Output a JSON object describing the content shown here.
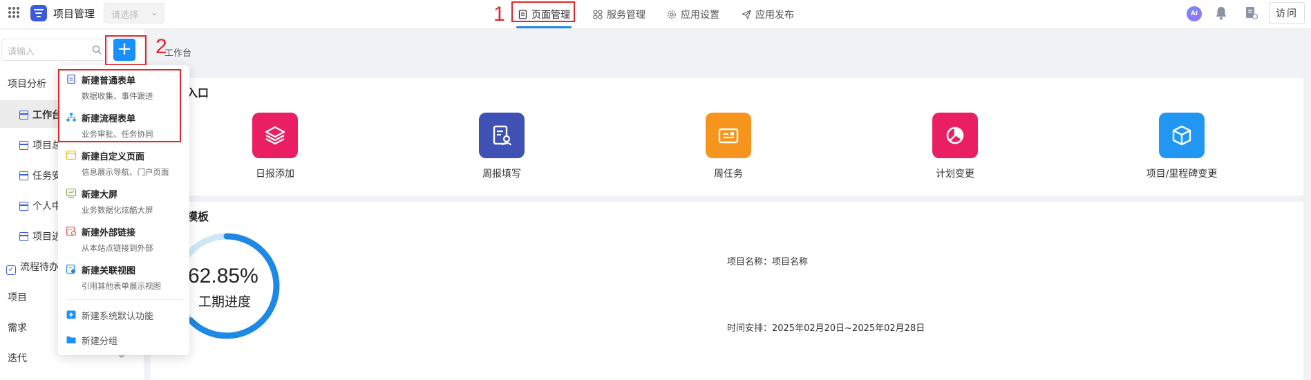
{
  "header": {
    "app_title": "项目管理",
    "app_select_placeholder": "请选择",
    "nav": [
      {
        "label": "页面管理",
        "icon": "page-icon",
        "active": true
      },
      {
        "label": "服务管理",
        "icon": "grid-services-icon",
        "active": false
      },
      {
        "label": "应用设置",
        "icon": "gear-icon",
        "active": false
      },
      {
        "label": "应用发布",
        "icon": "send-icon",
        "active": false
      }
    ],
    "ai_label": "AI",
    "visit_label": "访问",
    "accent": "#1e88e5"
  },
  "annotations": {
    "step1": "1",
    "step2": "2"
  },
  "sidebar": {
    "search_placeholder": "请输入",
    "add_label": "+",
    "groups": [
      {
        "label": "项目分析"
      },
      {
        "label": "流程待办"
      },
      {
        "label": "项目"
      },
      {
        "label": "需求"
      },
      {
        "label": "迭代"
      }
    ],
    "items": [
      {
        "label": "工作台",
        "selected": true
      },
      {
        "label": "项目总"
      },
      {
        "label": "任务安"
      },
      {
        "label": "个人中"
      },
      {
        "label": "项目进"
      }
    ]
  },
  "main": {
    "breadcrumb": "工作台",
    "entry_card_title": "入口",
    "entries": [
      {
        "label": "日报添加",
        "color": "#e91e63",
        "icon": "layers-icon"
      },
      {
        "label": "周报填写",
        "color": "#3f51b5",
        "icon": "report-user-icon"
      },
      {
        "label": "周任务",
        "color": "#f7941d",
        "icon": "id-card-icon"
      },
      {
        "label": "计划变更",
        "color": "#e91e63",
        "icon": "pie-chart-icon"
      },
      {
        "label": "项目/里程碑变更",
        "color": "#2196f3",
        "icon": "cube-icon"
      }
    ],
    "board_card_title": "模板",
    "progress": {
      "percent_text": "62.85%",
      "value": 0.6285,
      "label": "工期进度"
    },
    "project_name": "项目名称：项目名称",
    "schedule": "时间安排：2025年02月20日~2025年02月28日"
  },
  "menu": {
    "items": [
      {
        "title": "新建普通表单",
        "desc": "数据收集、事件跟进",
        "icon": "form-doc-icon",
        "color": "#3b5bdb"
      },
      {
        "title": "新建流程表单",
        "desc": "业务审批、任务协同",
        "icon": "flow-icon",
        "color": "#2196f3"
      },
      {
        "title": "新建自定义页面",
        "desc": "信息展示导航、门户页面",
        "icon": "custom-page-icon",
        "color": "#f7b500"
      },
      {
        "title": "新建大屏",
        "desc": "业务数据化炫酷大屏",
        "icon": "screen-icon",
        "color": "#7cb342"
      },
      {
        "title": "新建外部链接",
        "desc": "从本站点链接到外部",
        "icon": "link-icon",
        "color": "#ef5350"
      },
      {
        "title": "新建关联视图",
        "desc": "引用其他表单展示视图",
        "icon": "view-icon",
        "color": "#1e88e5"
      }
    ],
    "extras": [
      {
        "title": "新建系统默认功能",
        "icon": "plus-square-icon",
        "color": "#1890ff"
      },
      {
        "title": "新建分组",
        "icon": "folder-icon",
        "color": "#1890ff"
      }
    ]
  }
}
